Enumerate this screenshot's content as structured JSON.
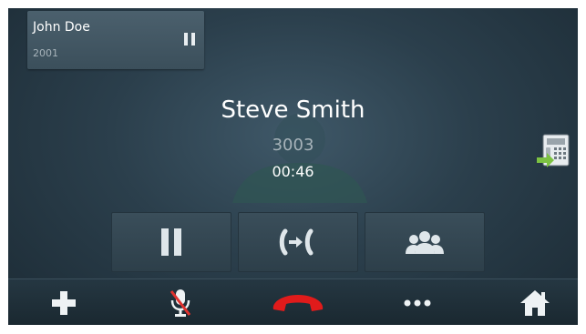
{
  "held_call": {
    "name": "John Doe",
    "number": "2001"
  },
  "active_call": {
    "name": "Steve Smith",
    "number": "3003",
    "timer": "00:46"
  },
  "icons": {
    "held_pause": "pause-icon",
    "transfer": "phone-transfer-icon",
    "hold": "pause-icon",
    "swap": "call-swap-icon",
    "conference": "conference-icon",
    "add": "plus-icon",
    "mute": "microphone-muted-icon",
    "hangup": "hangup-icon",
    "more": "more-icon",
    "home": "home-icon"
  },
  "colors": {
    "hangup": "#e01b1b",
    "mute_slash": "#e0322f",
    "transfer_arrow": "#7cc242"
  }
}
